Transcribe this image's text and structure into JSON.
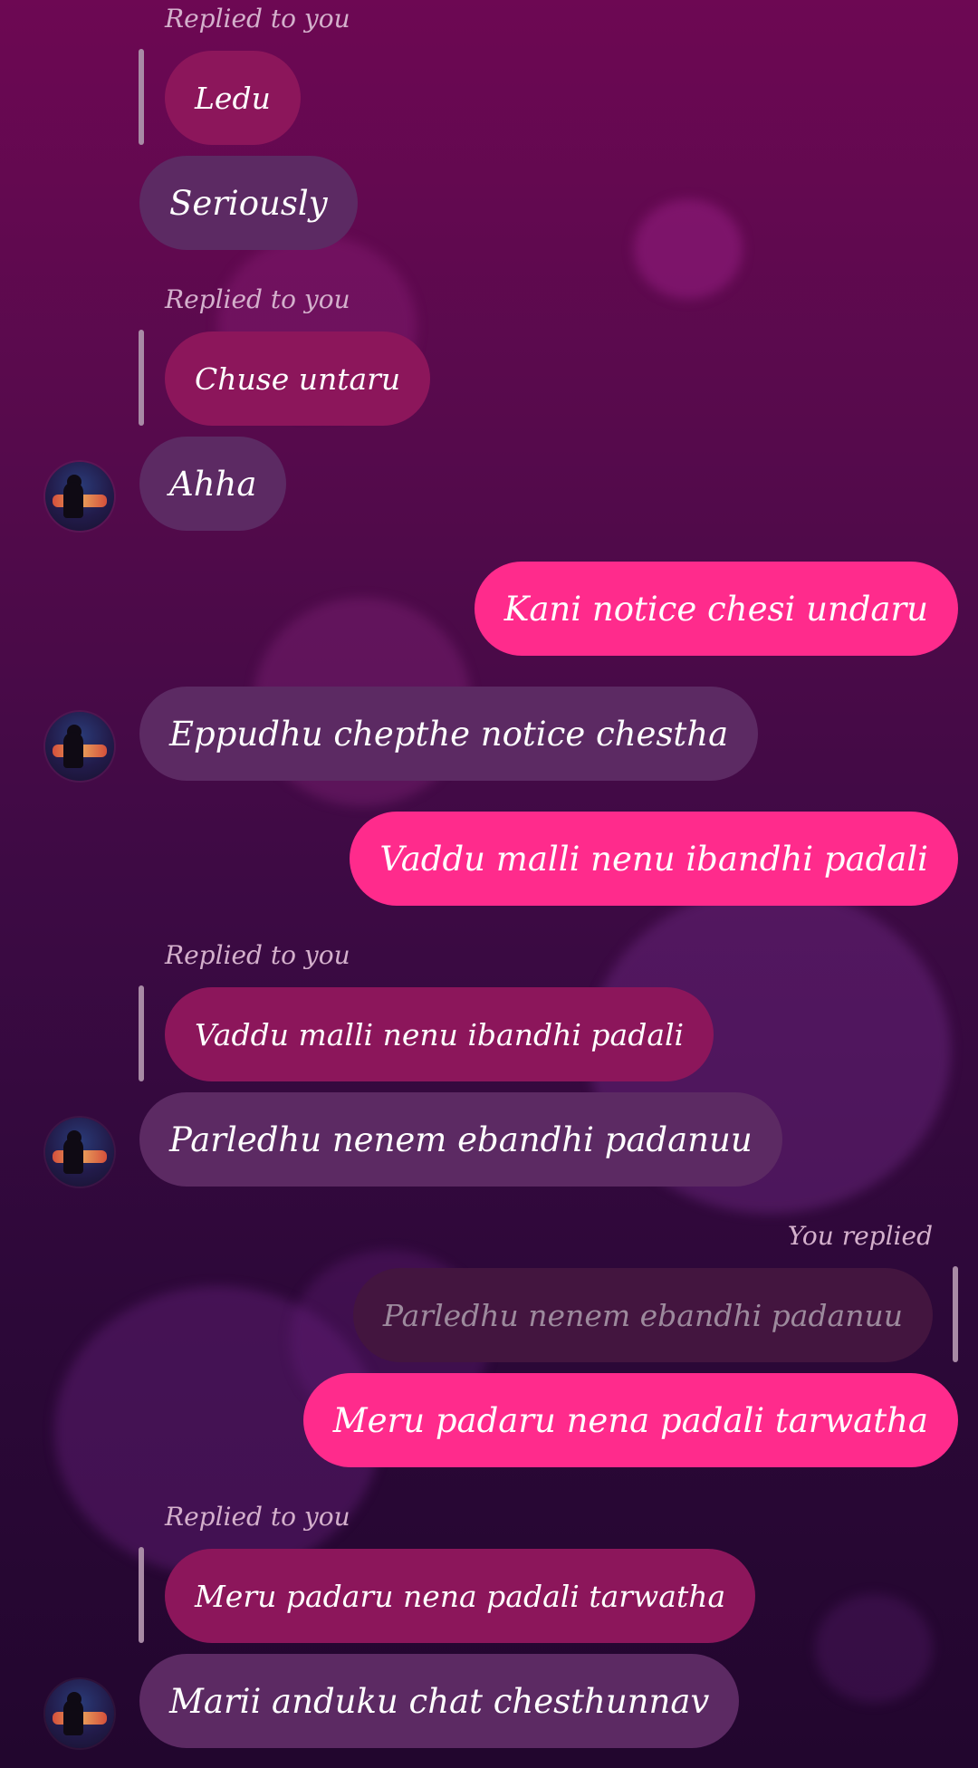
{
  "theme": {
    "incoming_bubble": "#5c2a63",
    "outgoing_bubble": "#ff2b8c",
    "replied_bubble": "#8c165b",
    "own_quoted_bubble": "#43153f"
  },
  "labels": {
    "replied_to_you": "Replied to you",
    "you_replied": "You replied"
  },
  "messages": [
    {
      "type": "reply_quote",
      "label": "Replied to you",
      "text": "Ledu"
    },
    {
      "type": "incoming",
      "text": "Seriously"
    },
    {
      "type": "reply_quote",
      "label": "Replied to you",
      "text": "Chuse untaru"
    },
    {
      "type": "incoming",
      "text": "Ahha",
      "avatar": "contact-avatar"
    },
    {
      "type": "outgoing",
      "text": "Kani notice chesi undaru"
    },
    {
      "type": "incoming",
      "text": "Eppudhu chepthe notice chestha",
      "avatar": "contact-avatar"
    },
    {
      "type": "outgoing",
      "text": "Vaddu malli nenu ibandhi padali"
    },
    {
      "type": "reply_quote",
      "label": "Replied to you",
      "text": "Vaddu malli nenu ibandhi padali"
    },
    {
      "type": "incoming",
      "text": "Parledhu nenem ebandhi padanuu",
      "avatar": "contact-avatar"
    },
    {
      "type": "own_reply_quote",
      "label": "You replied",
      "text": "Parledhu nenem ebandhi padanuu"
    },
    {
      "type": "outgoing",
      "text": "Meru padaru nena padali tarwatha"
    },
    {
      "type": "reply_quote",
      "label": "Replied to you",
      "text": "Meru padaru nena padali tarwatha"
    },
    {
      "type": "incoming",
      "text": "Marii anduku chat chesthunnav",
      "avatar": "contact-avatar"
    }
  ]
}
